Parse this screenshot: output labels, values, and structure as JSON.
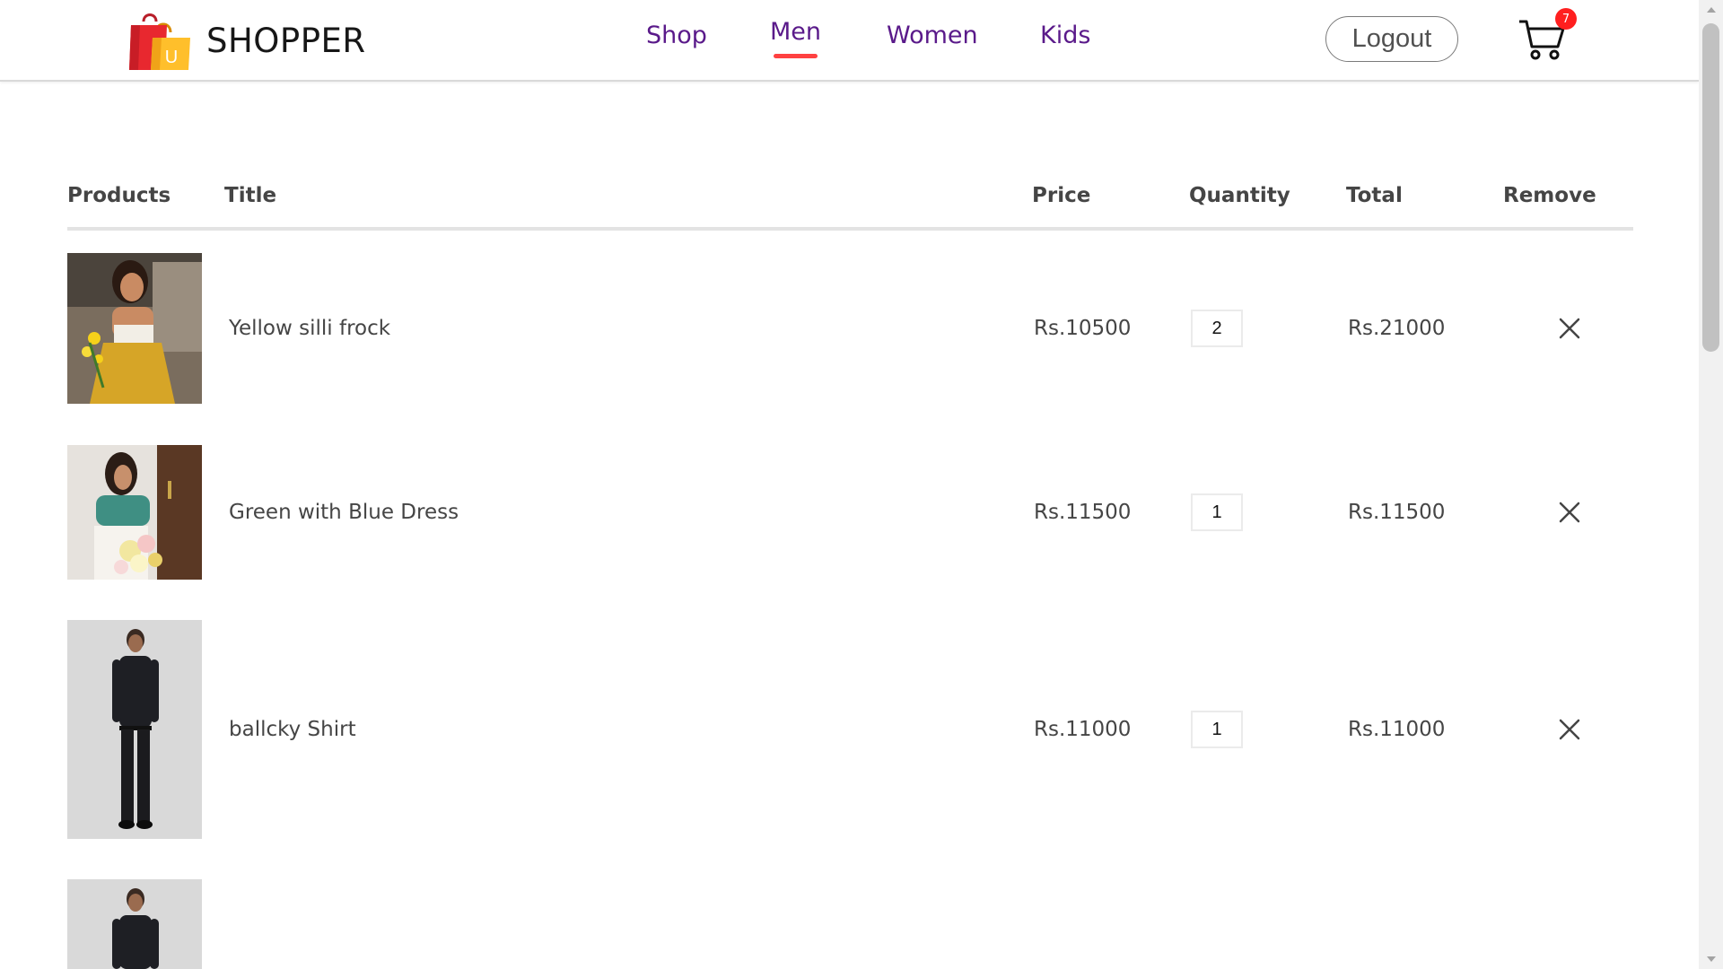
{
  "brand": {
    "name": "SHOPPER",
    "logo_letter": "U"
  },
  "nav": {
    "items": [
      {
        "label": "Shop",
        "active": false
      },
      {
        "label": "Men",
        "active": true
      },
      {
        "label": "Women",
        "active": false
      },
      {
        "label": "Kids",
        "active": false
      }
    ],
    "logout_label": "Logout",
    "cart_count": "7"
  },
  "cart": {
    "headers": {
      "products": "Products",
      "title": "Title",
      "price": "Price",
      "quantity": "Quantity",
      "total": "Total",
      "remove": "Remove"
    },
    "items": [
      {
        "title": "Yellow silli frock",
        "price": "Rs.10500",
        "quantity": "2",
        "total": "Rs.21000",
        "image": "woman-yellow-skirt-photo"
      },
      {
        "title": "Green with Blue Dress",
        "price": "Rs.11500",
        "quantity": "1",
        "total": "Rs.11500",
        "image": "woman-green-top-flowers-photo"
      },
      {
        "title": "ballcky Shirt",
        "price": "Rs.11000",
        "quantity": "1",
        "total": "Rs.11000",
        "image": "man-black-shirt-photo"
      },
      {
        "title": "",
        "price": "",
        "quantity": "",
        "total": "",
        "image": "man-black-shirt-photo"
      }
    ]
  },
  "colors": {
    "nav_text": "#5a1a8a",
    "active_underline": "#ff4141",
    "badge": "#ff1f1f",
    "text": "#454545"
  }
}
